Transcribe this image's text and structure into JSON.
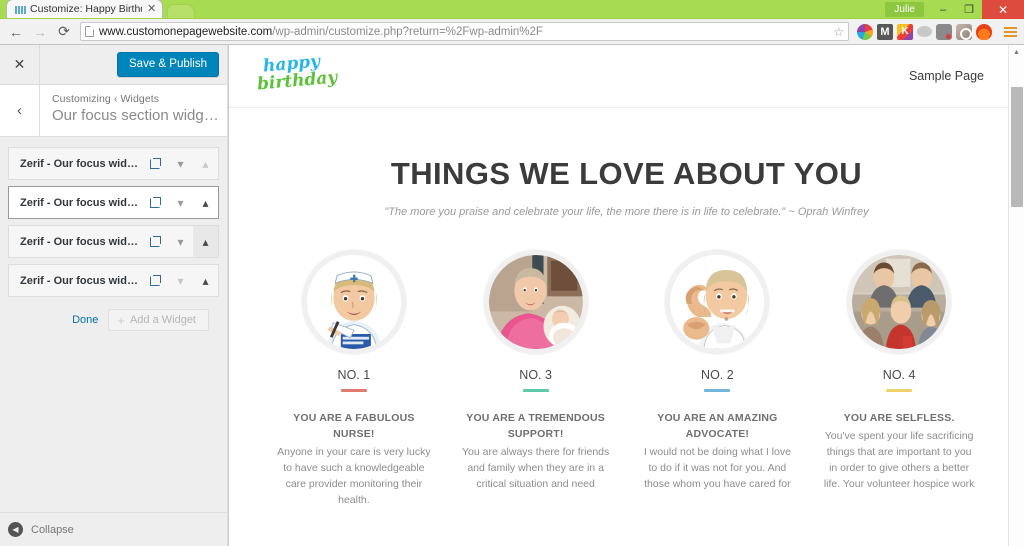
{
  "browser": {
    "tab": {
      "title": "Customize: Happy Birthda",
      "favicon": "bar-chart-favicon",
      "close": "✕"
    },
    "new_tab_label": "+",
    "user_button": "Julie",
    "window_controls": {
      "minimize": "–",
      "maximize": "❐",
      "close": "✕"
    },
    "nav": {
      "back": "←",
      "forward": "→",
      "reload": "⟳"
    },
    "url": {
      "host": "www.customonepagewebsite.com",
      "path": "/wp-admin/customize.php?return=%2Fwp-admin%2F",
      "full": "www.customonepagewebsite.com/wp-admin/customize.php?return=%2Fwp-admin%2F"
    },
    "star": "☆",
    "extensions": [
      {
        "name": "pinwheel-extension-icon",
        "label": ""
      },
      {
        "name": "gmail-extension-icon",
        "label": "M"
      },
      {
        "name": "kindle-extension-icon",
        "label": "K"
      },
      {
        "name": "pocket-extension-icon",
        "label": ""
      },
      {
        "name": "evernote-extension-icon",
        "label": ""
      },
      {
        "name": "instagram-extension-icon",
        "label": ""
      },
      {
        "name": "flame-extension-icon",
        "label": ""
      }
    ],
    "menu": "chrome-menu-icon"
  },
  "customizer": {
    "close_label": "✕",
    "save_label": "Save & Publish",
    "back_label": "‹",
    "breadcrumb": "Customizing ‹ Widgets",
    "panel_title": "Our focus section widg…",
    "widgets": [
      {
        "name": "Zerif - Our focus wid…",
        "state": "normal"
      },
      {
        "name": "Zerif - Our focus wid…",
        "state": "selected"
      },
      {
        "name": "Zerif - Our focus wid…",
        "state": "hover-up"
      },
      {
        "name": "Zerif - Our focus wid…",
        "state": "down-disabled"
      }
    ],
    "row_icons": {
      "external": "external-link-icon",
      "down": "⌄",
      "up": "⌃"
    },
    "done_label": "Done",
    "add_widget_label": "Add a Widget",
    "add_widget_plus": "+",
    "collapse_label": "Collapse",
    "collapse_icon": "◀",
    "accent_blue": "#0085ba",
    "link_blue": "#0073aa"
  },
  "preview": {
    "logo": {
      "line1": "happy",
      "line2": "birthday",
      "color1": "#29b6e8",
      "color2": "#5cc23a"
    },
    "nav": [
      {
        "label": "Sample Page"
      }
    ],
    "section": {
      "title": "THINGS WE LOVE ABOUT YOU",
      "subtitle": "\"The more you praise and celebrate your life, the more there is in life to celebrate.\" ~ Oprah Winfrey",
      "columns": [
        {
          "number": "NO. 1",
          "rule_color": "#e07b6e",
          "heading": "YOU ARE A FABULOUS NURSE!",
          "body": "Anyone in your care is very lucky to have such a knowledgeable care provider monitoring their health.",
          "image": "nurse-caricature-photo"
        },
        {
          "number": "NO. 3",
          "rule_color": "#5fc8a8",
          "heading": "YOU ARE A TREMENDOUS SUPPORT!",
          "body": "You are always there for friends and family when they are in a critical situation and need",
          "image": "woman-holding-baby-photo"
        },
        {
          "number": "NO. 2",
          "rule_color": "#72b5dd",
          "heading": "YOU ARE AN AMAZING ADVOCATE!",
          "body": "I would not be doing what I love to do if it was not for you. And those whom you have cared for",
          "image": "strong-arm-caricature-photo"
        },
        {
          "number": "NO. 4",
          "rule_color": "#efd06a",
          "heading": "YOU ARE SELFLESS.",
          "body": "You've spent your life sacrificing things that are important to you in order to give others a better life. Your volunteer hospice work",
          "image": "family-group-photo"
        }
      ]
    },
    "scroll_up_arrow": "▲"
  }
}
